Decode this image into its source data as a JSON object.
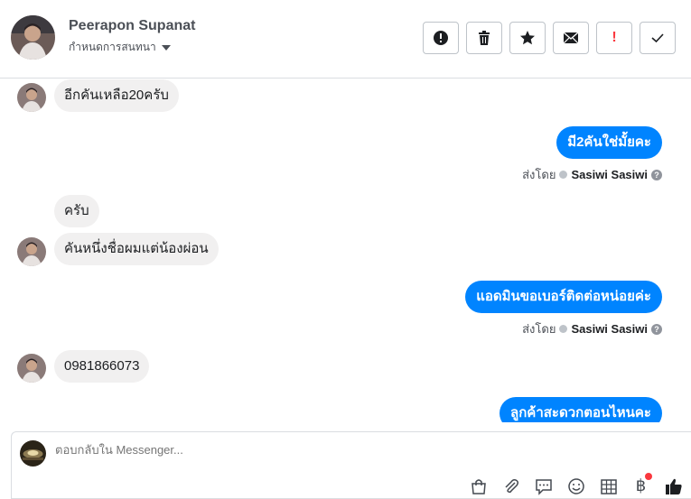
{
  "header": {
    "name": "Peerapon Supanat",
    "subtitle": "กำหนดการสนทนา",
    "actions": [
      {
        "name": "alert-icon"
      },
      {
        "name": "trash-icon"
      },
      {
        "name": "star-icon"
      },
      {
        "name": "envelope-icon"
      },
      {
        "name": "exclamation-icon",
        "label": "!"
      },
      {
        "name": "check-icon"
      }
    ]
  },
  "messages": [
    {
      "dir": "in",
      "text": "อีกคันเหลือ20ครับ",
      "avatar": true
    },
    {
      "dir": "out",
      "text": "มี2คันใช่มั้ยคะ"
    },
    {
      "dir": "meta",
      "label": "ส่งโดย",
      "who": "Sasiwi Sasiwi"
    },
    {
      "dir": "in",
      "text": "ครับ",
      "avatar": false
    },
    {
      "dir": "in",
      "text": "คันหนึ่งชื่อผมแต่น้องผ่อน",
      "avatar": true
    },
    {
      "dir": "out",
      "text": "แอดมินขอเบอร์ติดต่อหน่อยค่ะ"
    },
    {
      "dir": "meta",
      "label": "ส่งโดย",
      "who": "Sasiwi Sasiwi"
    },
    {
      "dir": "in",
      "text": "0981866073",
      "avatar": true
    },
    {
      "dir": "out",
      "text": "ลูกค้าสะดวกตอนไหนคะ"
    }
  ],
  "composer": {
    "placeholder": "ตอบกลับใน Messenger...",
    "tools": [
      "shopping-bag-icon",
      "paperclip-icon",
      "speech-bubble-icon",
      "smiley-icon",
      "table-icon",
      "baht-icon",
      "thumbs-up-icon"
    ],
    "baht_symbol": "฿"
  },
  "colors": {
    "outgoing": "#0084ff",
    "incoming": "#f1f0f0",
    "alert_red": "#fa383e"
  }
}
